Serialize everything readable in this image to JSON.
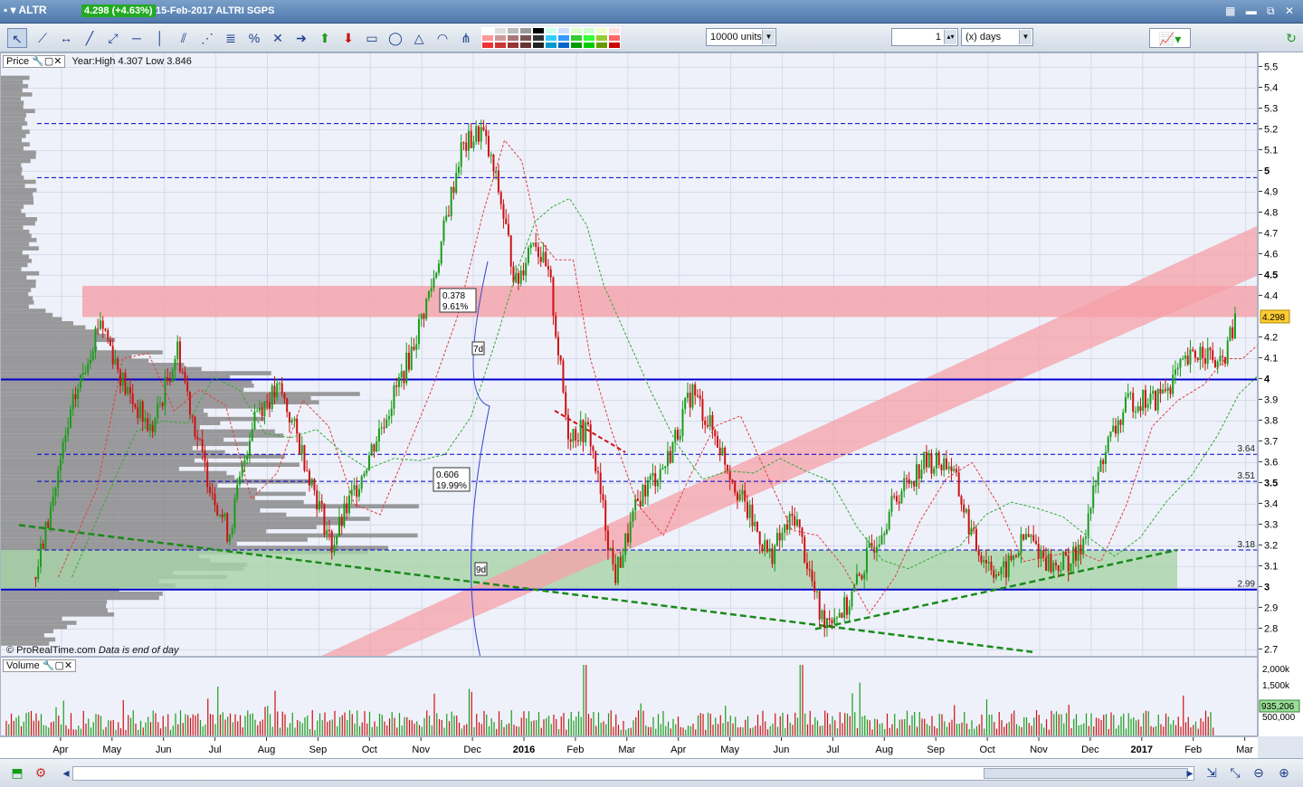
{
  "window": {
    "symbol": "ALTR",
    "quote": "4.298 (+4.63%)",
    "info": "15-Feb-2017 ALTRI SGPS"
  },
  "toolbar": {
    "units_value": "10000 units",
    "period_value": "1",
    "period_unit": "(x) days"
  },
  "price_panel": {
    "label": "Price",
    "yearly_range": "Year:High 4.307 Low 3.846",
    "credit": "© ProRealTime.com",
    "eod_note": "Data is end of day",
    "current_price_tag": "4.298",
    "level_tags": [
      "3.64",
      "3.51",
      "3.18",
      "2.99"
    ],
    "fib_boxes": [
      {
        "ratio": "0.378",
        "pct": "9.61%"
      },
      {
        "ratio": "0.606",
        "pct": "19.99%"
      }
    ],
    "time_marks": [
      "7d",
      "9d"
    ],
    "colors": {
      "candle_up": "#1a9c1a",
      "candle_down": "#cc1111",
      "support_line": "#0000cc",
      "red_zone": "#f5a0a8",
      "green_zone": "#a8d5a8",
      "volume_profile": "#8a8a8a"
    }
  },
  "volume_panel": {
    "label": "Volume",
    "current_volume_tag": "935,206"
  },
  "chart_data": {
    "type": "candlestick",
    "title": "",
    "xlabel": "",
    "ylabel": "",
    "x_ticks": [
      "Apr",
      "May",
      "Jun",
      "Jul",
      "Aug",
      "Sep",
      "Oct",
      "Nov",
      "Dec",
      "2016",
      "Feb",
      "Mar",
      "Apr",
      "May",
      "Jun",
      "Jul",
      "Aug",
      "Sep",
      "Oct",
      "Nov",
      "Dec",
      "2017",
      "Feb",
      "Mar"
    ],
    "y_ticks": [
      "5.5",
      "5.4",
      "5.3",
      "5.2",
      "5.1",
      "5",
      "4.9",
      "4.8",
      "4.7",
      "4.6",
      "4.5",
      "4.4",
      "4.2",
      "4.1",
      "4",
      "3.9",
      "3.8",
      "3.7",
      "3.6",
      "3.5",
      "3.4",
      "3.3",
      "3.2",
      "3.1",
      "3",
      "2.9",
      "2.8",
      "2.7"
    ],
    "ylim": [
      2.68,
      5.55
    ],
    "volume_y_ticks": [
      "2,000k",
      "1,500k",
      "500,000"
    ],
    "path_points": [
      [
        "Mar-2015",
        3.05
      ],
      [
        "Apr-2015",
        3.9
      ],
      [
        "Apr-2015",
        4.3
      ],
      [
        "May-2015",
        3.95
      ],
      [
        "May-2015",
        3.75
      ],
      [
        "Jun-2015",
        4.15
      ],
      [
        "Jun-2015",
        3.6
      ],
      [
        "Jul-2015",
        3.25
      ],
      [
        "Jul-2015",
        3.85
      ],
      [
        "Aug-2015",
        3.95
      ],
      [
        "Aug-2015",
        3.6
      ],
      [
        "Sep-2015",
        3.2
      ],
      [
        "Sep-2015",
        3.5
      ],
      [
        "Oct-2015",
        3.8
      ],
      [
        "Oct-2015",
        4.1
      ],
      [
        "Nov-2015",
        4.5
      ],
      [
        "Nov-2015",
        5.1
      ],
      [
        "Dec-2015",
        5.2
      ],
      [
        "Dec-2015",
        4.9
      ],
      [
        "Dec-2015",
        4.45
      ],
      [
        "Jan-2016",
        4.7
      ],
      [
        "Jan-2016",
        4.45
      ],
      [
        "Jan-2016",
        3.75
      ],
      [
        "Feb-2016",
        3.75
      ],
      [
        "Feb-2016",
        3.05
      ],
      [
        "Mar-2016",
        3.45
      ],
      [
        "Mar-2016",
        3.6
      ],
      [
        "Apr-2016",
        3.95
      ],
      [
        "Apr-2016",
        3.7
      ],
      [
        "May-2016",
        3.4
      ],
      [
        "May-2016",
        3.15
      ],
      [
        "Jun-2016",
        3.35
      ],
      [
        "Jun-2016",
        2.85
      ],
      [
        "Jul-2016",
        2.9
      ],
      [
        "Jul-2016",
        3.2
      ],
      [
        "Aug-2016",
        3.45
      ],
      [
        "Aug-2016",
        3.6
      ],
      [
        "Sep-2016",
        3.6
      ],
      [
        "Sep-2016",
        3.2
      ],
      [
        "Oct-2016",
        3.05
      ],
      [
        "Oct-2016",
        3.25
      ],
      [
        "Nov-2016",
        3.1
      ],
      [
        "Nov-2016",
        3.15
      ],
      [
        "Dec-2016",
        3.65
      ],
      [
        "Dec-2016",
        3.9
      ],
      [
        "Jan-2017",
        3.9
      ],
      [
        "Jan-2017",
        4.05
      ],
      [
        "Feb-2017",
        4.15
      ],
      [
        "Feb-2017",
        4.05
      ],
      [
        "Feb-2017",
        4.298
      ]
    ],
    "horizontal_levels": [
      {
        "value": 5.23,
        "style": "dashed"
      },
      {
        "value": 4.97,
        "style": "dashed"
      },
      {
        "value": 4.0,
        "style": "solid"
      },
      {
        "value": 3.64,
        "style": "dashed"
      },
      {
        "value": 3.51,
        "style": "dashed"
      },
      {
        "value": 3.18,
        "style": "dashed"
      },
      {
        "value": 2.99,
        "style": "solid"
      }
    ],
    "zones": [
      {
        "name": "red-resistance-zone",
        "from": 4.3,
        "to": 4.45
      },
      {
        "name": "green-support-zone",
        "from": 2.99,
        "to": 3.18
      }
    ],
    "grid": true,
    "legend": "none"
  }
}
